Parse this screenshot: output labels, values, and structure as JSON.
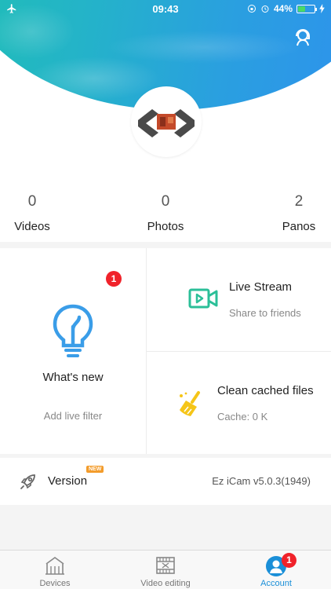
{
  "status_bar": {
    "time": "09:43",
    "battery": "44%",
    "battery_level": 0.44,
    "icons": [
      "airplane-icon",
      "orientation-lock-icon",
      "alarm-icon",
      "battery-icon",
      "charging-icon"
    ]
  },
  "header": {
    "support_icon": "customer-service-icon",
    "avatar_icon": "app-logo-icon"
  },
  "stats": [
    {
      "value": "0",
      "label": "Videos"
    },
    {
      "value": "0",
      "label": "Photos"
    },
    {
      "value": "2",
      "label": "Panos"
    }
  ],
  "features": {
    "whats_new": {
      "title": "What's new",
      "subtitle": "Add live filter",
      "badge": "1",
      "icon": "lightbulb-icon",
      "color": "#3a9de8"
    },
    "live_stream": {
      "title": "Live Stream",
      "subtitle": "Share to friends",
      "icon": "video-camera-icon",
      "color": "#2bbf98"
    },
    "clean_cache": {
      "title": "Clean cached files",
      "subtitle": "Cache: 0 K",
      "icon": "broom-icon",
      "color": "#f5c518"
    }
  },
  "version": {
    "label": "Version",
    "tag": "NEW",
    "value": "Ez iCam v5.0.3(1949)",
    "icon": "rocket-icon"
  },
  "tabbar": {
    "tabs": [
      {
        "label": "Devices",
        "icon": "house-icon",
        "active": false
      },
      {
        "label": "Video editing",
        "icon": "film-icon",
        "active": false
      },
      {
        "label": "Account",
        "icon": "person-icon",
        "active": true,
        "badge": "1"
      }
    ],
    "active_color": "#1a8fd8"
  }
}
